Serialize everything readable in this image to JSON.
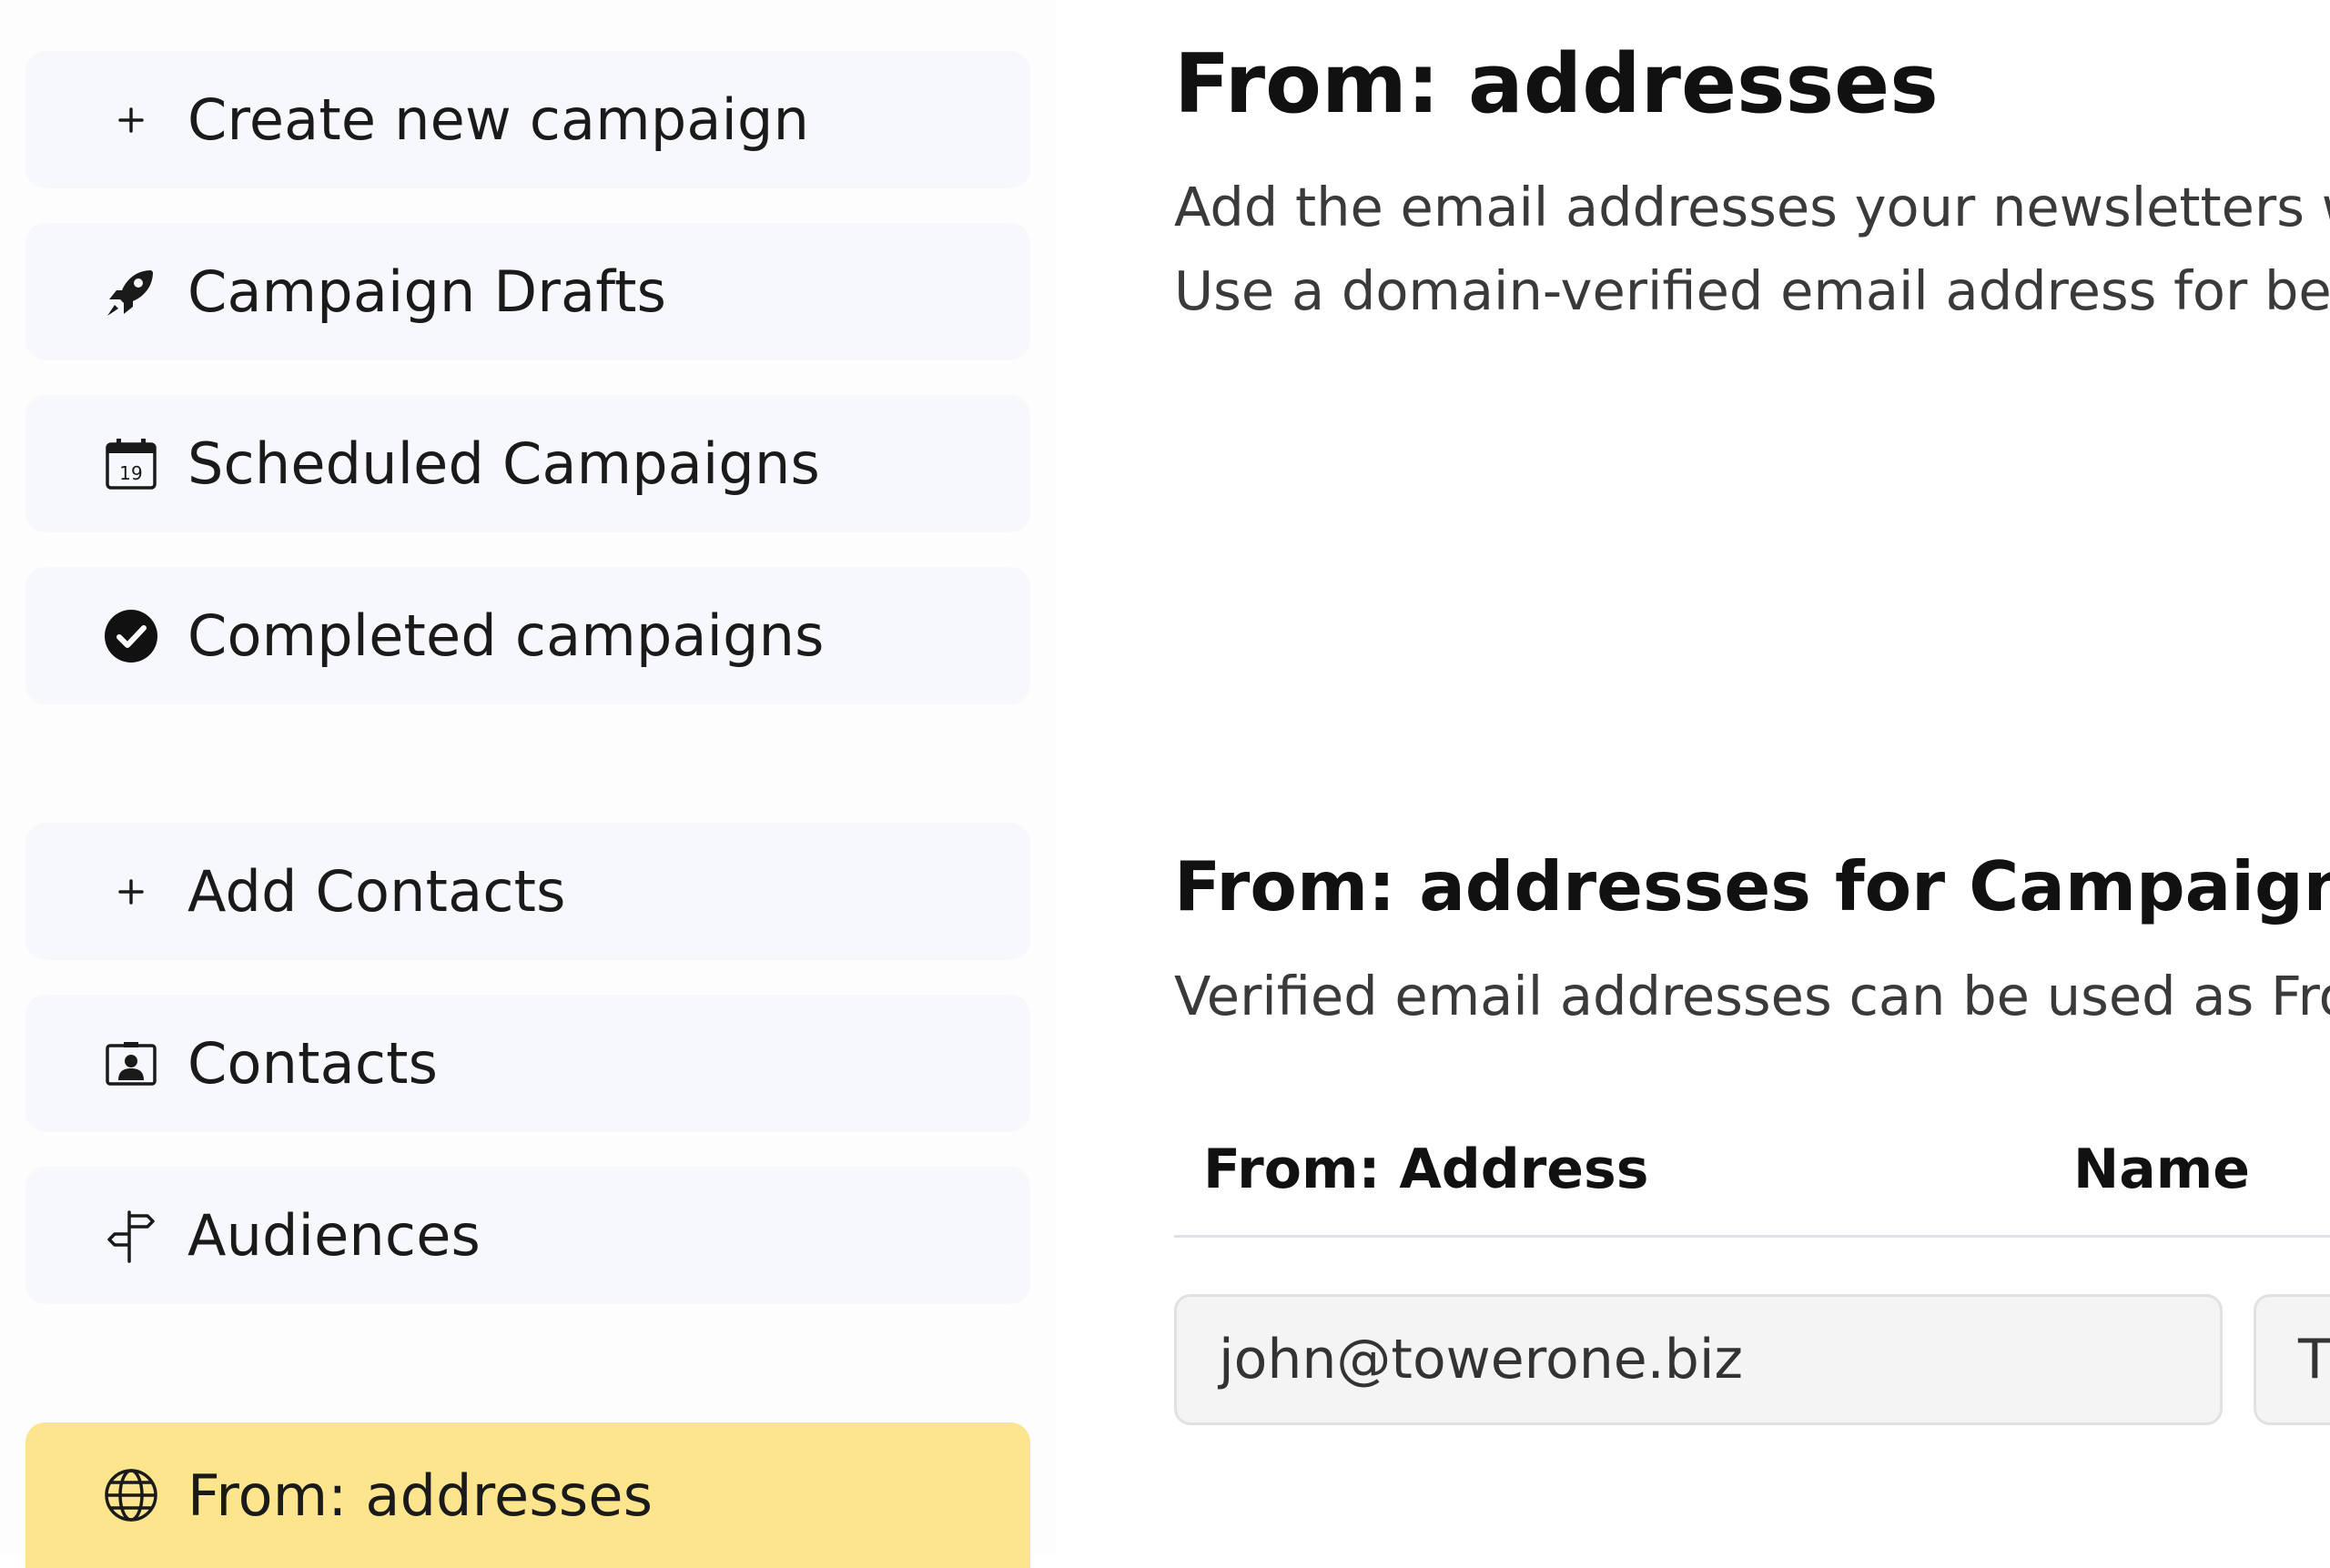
{
  "sidebar": {
    "items": [
      {
        "label": "Create new campaign",
        "icon": "plus-icon"
      },
      {
        "label": "Campaign Drafts",
        "icon": "rocket-icon"
      },
      {
        "label": "Scheduled Campaigns",
        "icon": "calendar-icon",
        "icon_text": "19"
      },
      {
        "label": "Completed campaigns",
        "icon": "check-circle-icon"
      },
      {
        "label": "Add Contacts",
        "icon": "plus-icon"
      },
      {
        "label": "Contacts",
        "icon": "contact-card-icon"
      },
      {
        "label": "Audiences",
        "icon": "signpost-icon"
      },
      {
        "label": "From: addresses",
        "icon": "globe-icon",
        "active": true
      }
    ],
    "active_color": "#fce58d",
    "item_bg_color": "#f7f8fc"
  },
  "main": {
    "title": "From: addresses",
    "description_line1": "Add the email addresses your newsletters wi",
    "description_line2": "Use a domain-verified email address for best",
    "section": {
      "title": "From: addresses for Campaigns",
      "description": "Verified email addresses can be used as Fron",
      "table": {
        "headers": [
          "From: Address",
          "Name"
        ],
        "rows": [
          {
            "address": "john@towerone.biz",
            "name": "T"
          }
        ]
      }
    }
  }
}
